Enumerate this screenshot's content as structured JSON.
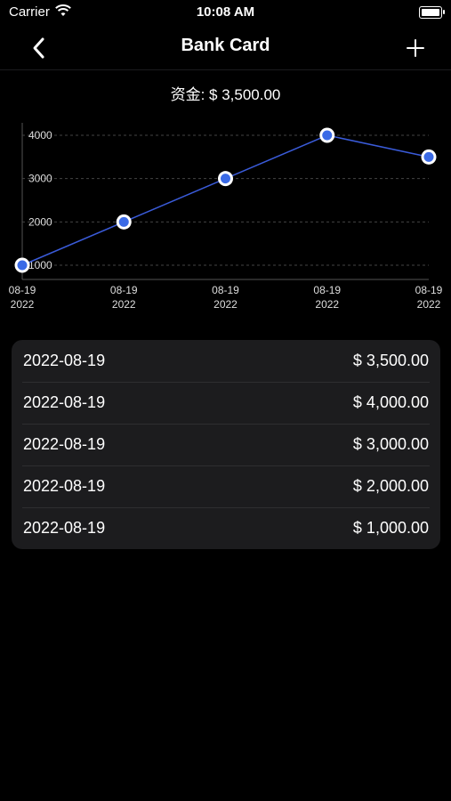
{
  "status": {
    "carrier": "Carrier",
    "time": "10:08 AM"
  },
  "nav": {
    "title": "Bank Card",
    "back_icon": "chevron-left-icon",
    "add_icon": "plus-icon"
  },
  "funds_label": "资金: $ 3,500.00",
  "colors": {
    "line": "#3a5bd9",
    "point": "#3a6ae6",
    "background": "#000000",
    "card": "#1c1c1e"
  },
  "chart_data": {
    "type": "line",
    "categories": [
      "08-19\n2022",
      "08-19\n2022",
      "08-19\n2022",
      "08-19\n2022",
      "08-19\n2022"
    ],
    "series": [
      {
        "values": [
          1000,
          2000,
          3000,
          4000,
          3500
        ]
      }
    ],
    "y_ticks": [
      "1000",
      "2000",
      "3000",
      "4000"
    ],
    "ylim": [
      1000,
      4000
    ],
    "grid": true
  },
  "records": [
    {
      "date": "2022-08-19",
      "amount": "$ 3,500.00"
    },
    {
      "date": "2022-08-19",
      "amount": "$ 4,000.00"
    },
    {
      "date": "2022-08-19",
      "amount": "$ 3,000.00"
    },
    {
      "date": "2022-08-19",
      "amount": "$ 2,000.00"
    },
    {
      "date": "2022-08-19",
      "amount": "$ 1,000.00"
    }
  ]
}
